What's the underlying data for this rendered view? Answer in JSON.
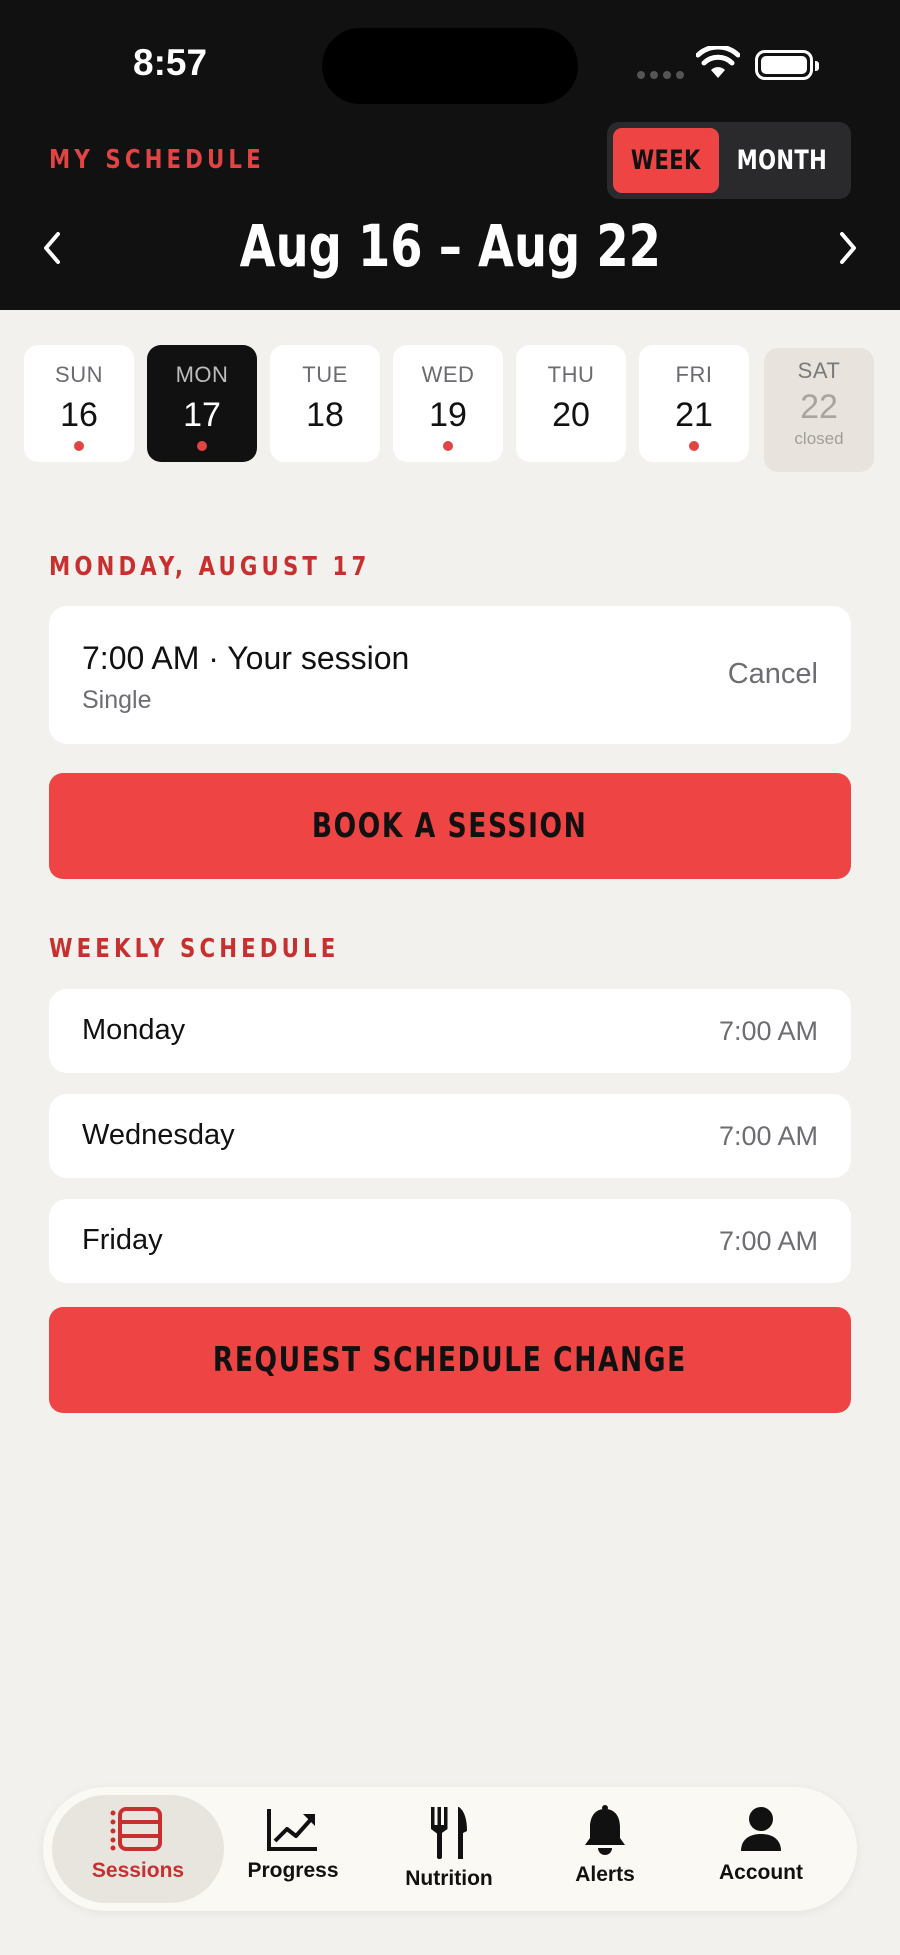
{
  "status_bar": {
    "time": "8:57"
  },
  "header": {
    "label": "MY SCHEDULE",
    "toggle": {
      "week": "WEEK",
      "month": "MONTH",
      "selected": "WEEK"
    },
    "range": "Aug 16 – Aug 22"
  },
  "days": [
    {
      "name": "SUN",
      "num": "16",
      "dot": true
    },
    {
      "name": "MON",
      "num": "17",
      "dot": true,
      "selected": true
    },
    {
      "name": "TUE",
      "num": "18",
      "dot": false
    },
    {
      "name": "WED",
      "num": "19",
      "dot": true
    },
    {
      "name": "THU",
      "num": "20",
      "dot": false
    },
    {
      "name": "FRI",
      "num": "21",
      "dot": true
    },
    {
      "name": "SAT",
      "num": "22",
      "sub": "closed",
      "closed": true
    }
  ],
  "selected_day": {
    "title": "MONDAY, AUGUST 17",
    "session": {
      "title": "7:00 AM · Your session",
      "type": "Single",
      "cancel": "Cancel"
    },
    "book_button": "BOOK A SESSION"
  },
  "weekly": {
    "title": "WEEKLY SCHEDULE",
    "rows": [
      {
        "day": "Monday",
        "time": "7:00 AM"
      },
      {
        "day": "Wednesday",
        "time": "7:00 AM"
      },
      {
        "day": "Friday",
        "time": "7:00 AM"
      }
    ],
    "request_button": "REQUEST SCHEDULE CHANGE"
  },
  "tabs": [
    {
      "label": "Sessions",
      "icon": "sessions-icon",
      "active": true
    },
    {
      "label": "Progress",
      "icon": "progress-icon"
    },
    {
      "label": "Nutrition",
      "icon": "nutrition-icon"
    },
    {
      "label": "Alerts",
      "icon": "bell-icon"
    },
    {
      "label": "Account",
      "icon": "account-icon"
    }
  ],
  "colors": {
    "accent": "#EF4444",
    "accent_text": "#C83030",
    "dark": "#111111",
    "background": "#F3F1ED"
  }
}
